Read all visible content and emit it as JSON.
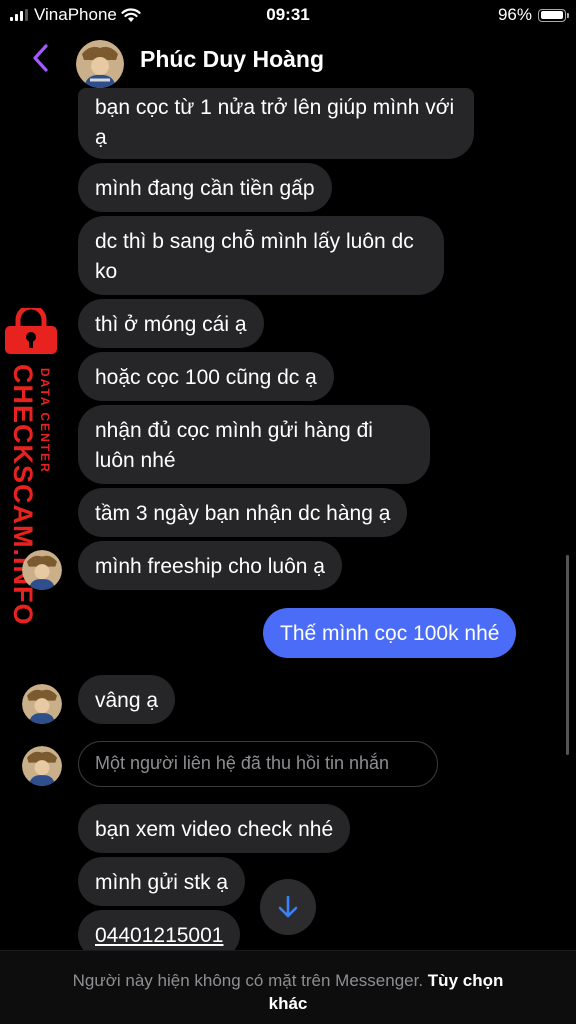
{
  "status_bar": {
    "carrier": "VinaPhone",
    "time": "09:31",
    "battery": "96%",
    "battery_level": 0.96
  },
  "header": {
    "contact_name": "Phúc Duy Hoàng"
  },
  "messages": [
    {
      "text": "bạn cọc từ 1 nửa trở lên giúp mình với ạ",
      "from": "contact"
    },
    {
      "text": "mình đang cần tiền gấp",
      "from": "contact"
    },
    {
      "text": "dc thì b sang chỗ mình lấy luôn dc ko",
      "from": "contact"
    },
    {
      "text": "thì ở móng cái ạ",
      "from": "contact"
    },
    {
      "text": "hoặc cọc 100 cũng dc ạ",
      "from": "contact"
    },
    {
      "text": "nhận đủ cọc mình gửi hàng đi luôn nhé",
      "from": "contact"
    },
    {
      "text": "tầm 3 ngày bạn nhận dc hàng ạ",
      "from": "contact"
    },
    {
      "text": "mình freeship cho luôn ạ",
      "from": "contact"
    },
    {
      "text": "Thế mình cọc 100k nhé",
      "from": "me"
    },
    {
      "text": "vâng ạ",
      "from": "contact"
    },
    {
      "text": "Một người liên hệ đã thu hồi tin nhắn",
      "from": "system"
    },
    {
      "text": "bạn xem video check nhé",
      "from": "contact"
    },
    {
      "text": "mình gửi stk ạ",
      "from": "contact"
    },
    {
      "text": "04401215001",
      "from": "contact"
    }
  ],
  "watermark": {
    "title": "CHECKSCAM.INFO",
    "subtitle": "DATA CENTER"
  },
  "footer": {
    "note": "Người này hiện không có mặt trên Messenger.",
    "action": "Tùy chọn khác"
  },
  "icons": {
    "back": "chevron-left-icon",
    "scroll_down": "arrow-down-icon",
    "lock": "lock-icon"
  },
  "colors": {
    "accent": "#a259ff",
    "my_bubble": "#4b6cf7",
    "their_bubble": "#262628",
    "watermark": "#e8231f",
    "arrow": "#3a82f7"
  }
}
